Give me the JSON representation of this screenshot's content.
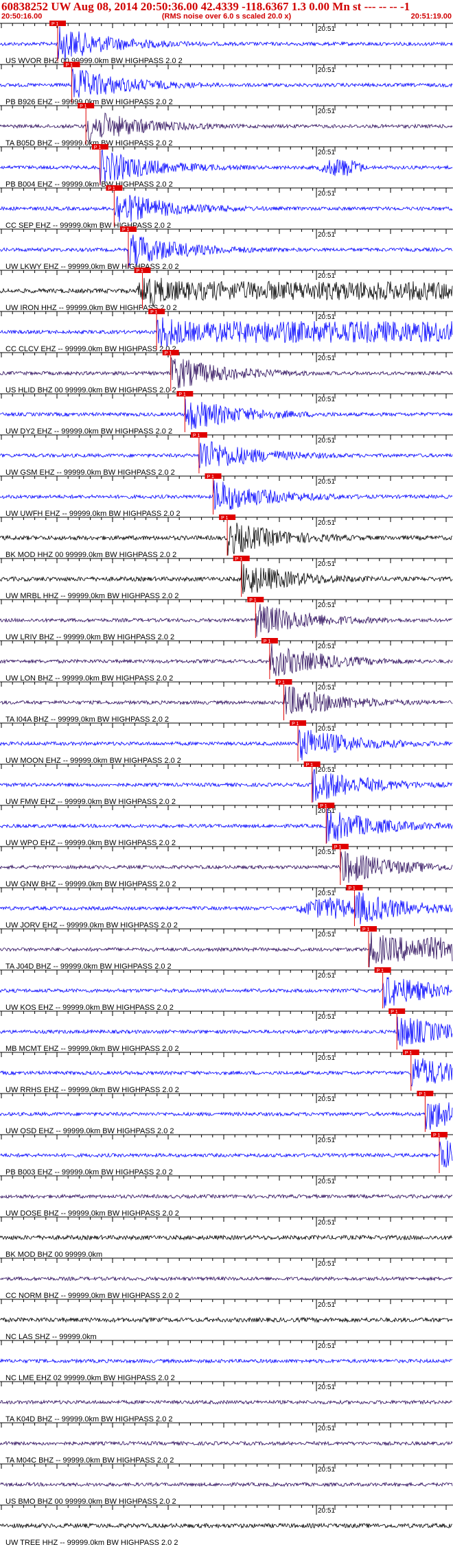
{
  "header": {
    "title": "60838252 UW Aug 08, 2014 20:50:36.00   42.4339 -118.6367  1.3 0.00 Mn st --- -- --  -1",
    "start_time": "20:50:16.00",
    "note": "(RMS noise over 6.0 s scaled 20.0 x)",
    "end_time": "20:51:19.00"
  },
  "minute_marker": "20:51",
  "pick_label": "P 1",
  "colors": {
    "red": "#e00000",
    "blue": "#0000ff",
    "purple": "#2a0a5a",
    "black": "#000000"
  },
  "traces": [
    {
      "label": "US WVOR BHZ 00 99999.0km BW  HIGHPASS  2.0  2",
      "color": "blue"
    },
    {
      "label": "PB B926 EHZ -- 99999.0km BW  HIGHPASS  2.0  2",
      "color": "blue"
    },
    {
      "label": "TA B05D BHZ -- 99999.0km BW  HIGHPASS  2.0  2",
      "color": "purple"
    },
    {
      "label": "PB B004 EHZ -- 99999.0km BW  HIGHPASS  2.0  2",
      "color": "blue"
    },
    {
      "label": "CC SEP EHZ -- 99999.0km BW  HIGHPASS  2.0  2",
      "color": "blue"
    },
    {
      "label": "UW LKWY EHZ -- 99999.0km BW  HIGHPASS  2.0  2",
      "color": "blue"
    },
    {
      "label": "UW IRON HHZ -- 99999.0km BW  HIGHPASS  2.0  2",
      "color": "black"
    },
    {
      "label": "CC CLCV EHZ -- 99999.0km BW  HIGHPASS  2.0  2",
      "color": "blue"
    },
    {
      "label": "US HLID BHZ 00 99999.0km BW  HIGHPASS  2.0  2",
      "color": "purple"
    },
    {
      "label": "UW DY2 EHZ -- 99999.0km BW  HIGHPASS  2.0  2",
      "color": "blue"
    },
    {
      "label": "UW GSM EHZ -- 99999.0km BW  HIGHPASS  2.0  2",
      "color": "blue"
    },
    {
      "label": "UW UWFH EHZ -- 99999.0km BW  HIGHPASS  2.0  2",
      "color": "blue"
    },
    {
      "label": "BK MOD HHZ 00 99999.0km BW  HIGHPASS  2.0  2",
      "color": "black"
    },
    {
      "label": "UW MRBL HHZ -- 99999.0km BW  HIGHPASS  2.0  2",
      "color": "black"
    },
    {
      "label": "UW LRIV BHZ -- 99999.0km BW  HIGHPASS  2.0  2",
      "color": "purple"
    },
    {
      "label": "UW LON BHZ -- 99999.0km BW  HIGHPASS  2.0  2",
      "color": "purple"
    },
    {
      "label": "TA I04A BHZ -- 99999.0km BW  HIGHPASS  2.0  2",
      "color": "purple"
    },
    {
      "label": "UW MOON EHZ -- 99999.0km BW  HIGHPASS  2.0  2",
      "color": "blue"
    },
    {
      "label": "UW FMW EHZ -- 99999.0km BW  HIGHPASS  2.0  2",
      "color": "blue"
    },
    {
      "label": "UW WPO EHZ -- 99999.0km BW  HIGHPASS  2.0  2",
      "color": "blue"
    },
    {
      "label": "UW GNW BHZ -- 99999.0km BW  HIGHPASS  2.0  2",
      "color": "purple"
    },
    {
      "label": "UW JORV EHZ -- 99999.0km BW  HIGHPASS  2.0  2",
      "color": "blue"
    },
    {
      "label": "TA J04D BHZ -- 99999.0km BW  HIGHPASS  2.0  2",
      "color": "purple"
    },
    {
      "label": "UW KOS EHZ -- 99999.0km BW  HIGHPASS  2.0  2",
      "color": "blue"
    },
    {
      "label": "MB MCMT EHZ -- 99999.0km BW  HIGHPASS  2.0  2",
      "color": "blue"
    },
    {
      "label": "UW RRHS EHZ -- 99999.0km BW  HIGHPASS  2.0  2",
      "color": "blue"
    },
    {
      "label": "UW OSD EHZ -- 99999.0km BW  HIGHPASS  2.0  2",
      "color": "blue"
    },
    {
      "label": "PB B003 EHZ -- 99999.0km BW  HIGHPASS  2.0  2",
      "color": "blue"
    },
    {
      "label": "UW DOSE BHZ -- 99999.0km BW  HIGHPASS  2.0  2",
      "color": "purple"
    },
    {
      "label": "BK MOD BHZ 00 99999.0km",
      "color": "black"
    },
    {
      "label": "CC NORM BHZ -- 99999.0km BW  HIGHPASS  2.0  2",
      "color": "purple"
    },
    {
      "label": "NC LAS SHZ -- 99999.0km",
      "color": "black"
    },
    {
      "label": "NC LME EHZ 02 99999.0km BW  HIGHPASS  2.0  2",
      "color": "blue"
    },
    {
      "label": "TA K04D BHZ -- 99999.0km BW  HIGHPASS  2.0  2",
      "color": "purple"
    },
    {
      "label": "TA M04C BHZ -- 99999.0km BW  HIGHPASS  2.0  2",
      "color": "purple"
    },
    {
      "label": "US BMO BHZ 00 99999.0km BW  HIGHPASS  2.0  2",
      "color": "purple"
    },
    {
      "label": "UW TREE HHZ -- 99999.0km BW  HIGHPASS  2.0  2",
      "color": "black"
    }
  ]
}
